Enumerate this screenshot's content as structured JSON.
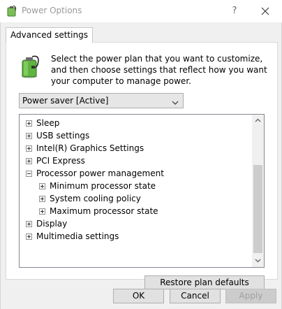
{
  "window": {
    "title": "Power Options",
    "help_label": "?",
    "close_icon": "close-icon",
    "app_icon": "power-options-icon"
  },
  "tabs": [
    {
      "label": "Advanced settings",
      "active": true
    }
  ],
  "description": "Select the power plan that you want to customize, and then choose settings that reflect how you want your computer to manage power.",
  "plan_select": {
    "value": "Power saver [Active]"
  },
  "tree": {
    "items": [
      {
        "label": "Sleep",
        "level": 0,
        "expanded": false
      },
      {
        "label": "USB settings",
        "level": 0,
        "expanded": false
      },
      {
        "label": "Intel(R) Graphics Settings",
        "level": 0,
        "expanded": false
      },
      {
        "label": "PCI Express",
        "level": 0,
        "expanded": false
      },
      {
        "label": "Processor power management",
        "level": 0,
        "expanded": true
      },
      {
        "label": "Minimum processor state",
        "level": 1,
        "expanded": false
      },
      {
        "label": "System cooling policy",
        "level": 1,
        "expanded": false
      },
      {
        "label": "Maximum processor state",
        "level": 1,
        "expanded": false
      },
      {
        "label": "Display",
        "level": 0,
        "expanded": false
      },
      {
        "label": "Multimedia settings",
        "level": 0,
        "expanded": false
      }
    ],
    "scroll_position": 0.62
  },
  "restore_button": "Restore plan defaults",
  "buttons": {
    "ok": "OK",
    "cancel": "Cancel",
    "apply": "Apply"
  },
  "colors": {
    "dialog_bg": "#f0f0f0",
    "disabled_text": "#a0a0a0"
  }
}
